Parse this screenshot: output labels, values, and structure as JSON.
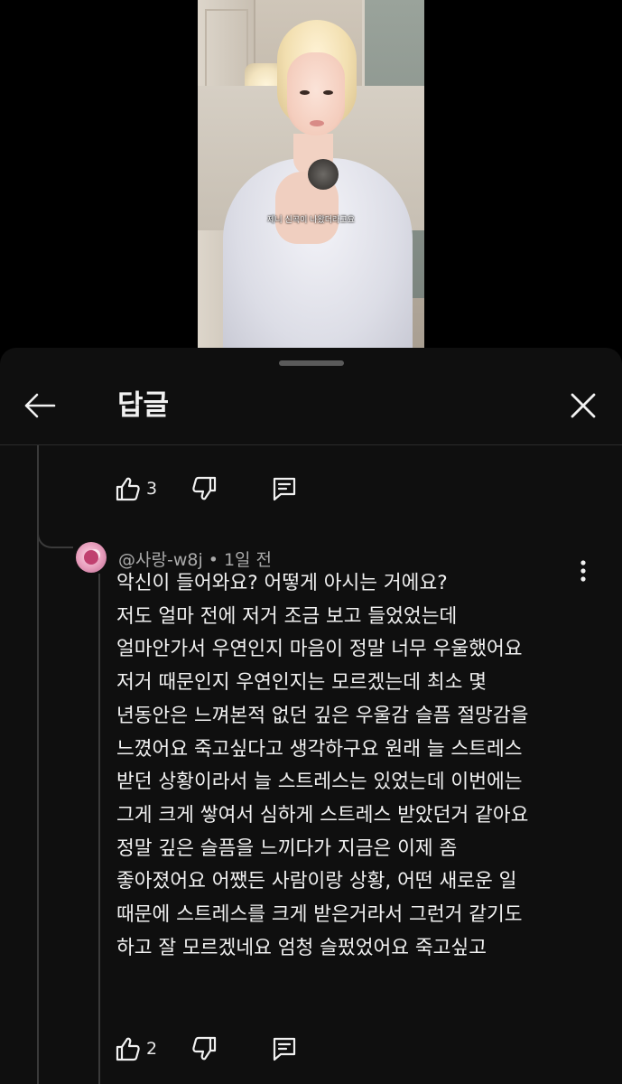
{
  "video": {
    "caption": "제니 신곡이 나왔더라고요"
  },
  "header": {
    "title": "답글",
    "back_icon": "arrow-left-icon",
    "close_icon": "close-icon"
  },
  "parent_comment": {
    "like_count": "3"
  },
  "reply": {
    "author": "@사랑-w8j",
    "separator": "•",
    "time": "1일 전",
    "lines": [
      "악신이 들어와요? 어떻게 아시는 거에요?",
      "저도 얼마 전에 저거 조금 보고 들었었는데",
      "얼마안가서 우연인지 마음이 정말 너무 우울했어요",
      "저거 때문인지 우연인지는 모르겠는데 최소 몇",
      "년동안은 느껴본적 없던 깊은 우울감 슬픔 절망감을",
      "느꼈어요 죽고싶다고 생각하구요 원래 늘 스트레스",
      "받던 상황이라서 늘 스트레스는 있었는데 이번에는",
      "그게 크게 쌓여서 심하게 스트레스 받았던거 같아요",
      "정말 깊은 슬픔을 느끼다가 지금은 이제 좀",
      "좋아졌어요 어쨌든 사람이랑 상황, 어떤 새로운 일",
      "때문에 스트레스를 크게 받은거라서 그런거 같기도",
      "하고 잘 모르겠네요 엄청 슬펐었어요 죽고싶고"
    ],
    "like_count": "2"
  },
  "colors": {
    "background": "#000000",
    "sheet": "#0f0f0f",
    "text": "#f1f1f1",
    "meta": "#aaaaaa",
    "thread_line": "#3a3a3a"
  }
}
